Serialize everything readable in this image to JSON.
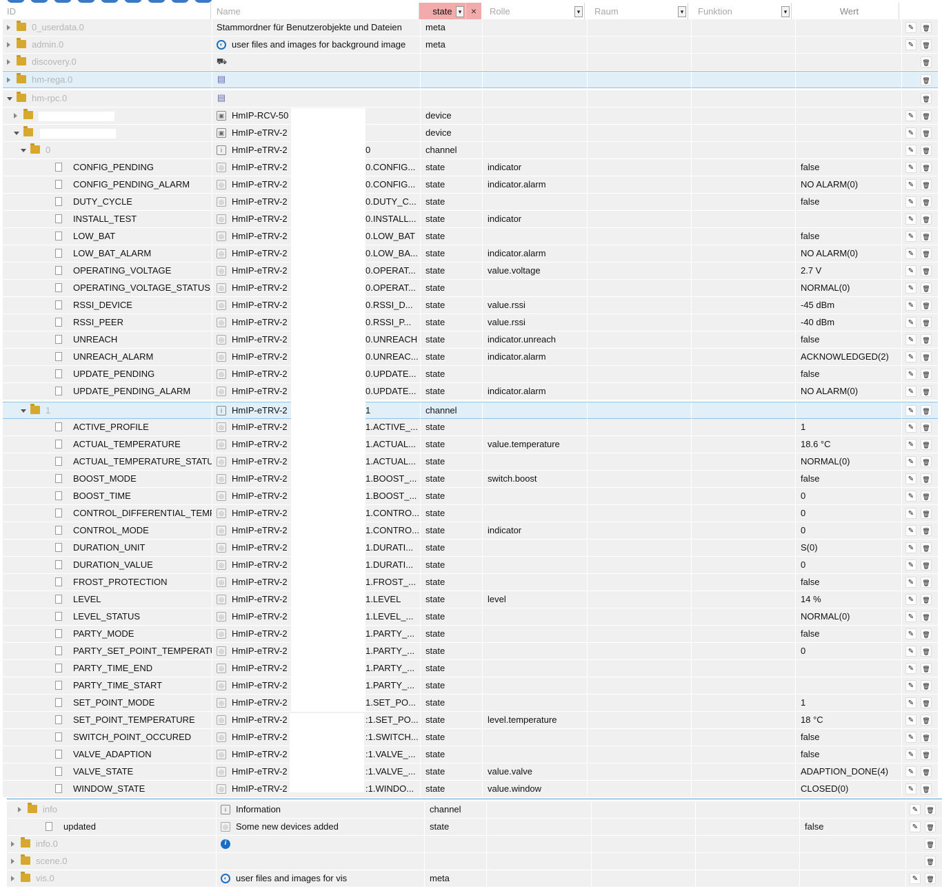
{
  "header": {
    "id_label": "ID",
    "name_label": "Name",
    "type_filter": "state",
    "role_label": "Rolle",
    "room_label": "Raum",
    "function_label": "Funktion",
    "value_label": "Wert",
    "clear_symbol": "×",
    "dropdown_symbol": "▾"
  },
  "rows": [
    {
      "id": "0_userdata.0",
      "name": "Stammordner für Benutzerobjekte und Dateien",
      "type": "meta",
      "role": "",
      "value": "",
      "level": 0,
      "kind": "folder",
      "toggle": "c",
      "icon": "",
      "dim": true,
      "edit": true
    },
    {
      "id": "admin.0",
      "name": "user files and images for background image",
      "type": "meta",
      "role": "",
      "value": "",
      "level": 0,
      "kind": "folder",
      "toggle": "c",
      "icon": "meta",
      "dim": true,
      "edit": true
    },
    {
      "id": "discovery.0",
      "name": "",
      "type": "",
      "role": "",
      "value": "",
      "level": 0,
      "kind": "folder",
      "toggle": "c",
      "icon": "bin",
      "dim": true,
      "edit": false
    },
    {
      "id": "hm-rega.0",
      "name": "",
      "type": "",
      "role": "",
      "value": "",
      "level": 0,
      "kind": "folder",
      "toggle": "c",
      "icon": "doc",
      "dim": true,
      "edit": false,
      "sel": true
    },
    {
      "id": "hm-rpc.0",
      "name": "",
      "type": "",
      "role": "",
      "value": "",
      "level": 0,
      "kind": "folder",
      "toggle": "o",
      "icon": "doc",
      "dim": true,
      "edit": false
    },
    {
      "id": "",
      "name": "HmIP-RCV-50",
      "type": "device",
      "role": "",
      "value": "",
      "level": 1,
      "kind": "folder",
      "toggle": "c",
      "icon": "dev",
      "dim": true,
      "edit": true
    },
    {
      "id": "",
      "name": "HmIP-eTRV-2",
      "type": "device",
      "role": "",
      "value": "",
      "level": 1,
      "kind": "folder",
      "toggle": "o",
      "icon": "dev",
      "dim": true,
      "edit": true
    },
    {
      "id": "0",
      "name": "HmIP-eTRV-2",
      "tail": "0",
      "type": "channel",
      "role": "",
      "value": "",
      "level": 2,
      "kind": "folder",
      "toggle": "o",
      "icon": "ch",
      "dim": true,
      "edit": true
    },
    {
      "id": "CONFIG_PENDING",
      "name": "HmIP-eTRV-2",
      "tail": "0.CONFIG...",
      "type": "state",
      "role": "indicator",
      "value": "false",
      "level": 3,
      "kind": "file",
      "icon": "st",
      "edit": true
    },
    {
      "id": "CONFIG_PENDING_ALARM",
      "name": "HmIP-eTRV-2",
      "tail": "0.CONFIG...",
      "type": "state",
      "role": "indicator.alarm",
      "value": "NO ALARM(0)",
      "level": 3,
      "kind": "file",
      "icon": "st",
      "edit": true
    },
    {
      "id": "DUTY_CYCLE",
      "name": "HmIP-eTRV-2",
      "tail": "0.DUTY_C...",
      "type": "state",
      "role": "",
      "value": "false",
      "level": 3,
      "kind": "file",
      "icon": "st",
      "edit": true
    },
    {
      "id": "INSTALL_TEST",
      "name": "HmIP-eTRV-2",
      "tail": "0.INSTALL...",
      "type": "state",
      "role": "indicator",
      "value": "",
      "level": 3,
      "kind": "file",
      "icon": "st",
      "edit": true
    },
    {
      "id": "LOW_BAT",
      "name": "HmIP-eTRV-2",
      "tail": "0.LOW_BAT",
      "type": "state",
      "role": "",
      "value": "false",
      "level": 3,
      "kind": "file",
      "icon": "st",
      "edit": true
    },
    {
      "id": "LOW_BAT_ALARM",
      "name": "HmIP-eTRV-2",
      "tail": "0.LOW_BA...",
      "type": "state",
      "role": "indicator.alarm",
      "value": "NO ALARM(0)",
      "level": 3,
      "kind": "file",
      "icon": "st",
      "edit": true
    },
    {
      "id": "OPERATING_VOLTAGE",
      "name": "HmIP-eTRV-2",
      "tail": "0.OPERAT...",
      "type": "state",
      "role": "value.voltage",
      "value": "2.7 V",
      "level": 3,
      "kind": "file",
      "icon": "st",
      "edit": true
    },
    {
      "id": "OPERATING_VOLTAGE_STATUS",
      "name": "HmIP-eTRV-2",
      "tail": "0.OPERAT...",
      "type": "state",
      "role": "",
      "value": "NORMAL(0)",
      "level": 3,
      "kind": "file",
      "icon": "st",
      "edit": true
    },
    {
      "id": "RSSI_DEVICE",
      "name": "HmIP-eTRV-2",
      "tail": "0.RSSI_D...",
      "type": "state",
      "role": "value.rssi",
      "value": "-45 dBm",
      "level": 3,
      "kind": "file",
      "icon": "st",
      "edit": true
    },
    {
      "id": "RSSI_PEER",
      "name": "HmIP-eTRV-2",
      "tail": "0.RSSI_P...",
      "type": "state",
      "role": "value.rssi",
      "value": "-40 dBm",
      "level": 3,
      "kind": "file",
      "icon": "st",
      "edit": true
    },
    {
      "id": "UNREACH",
      "name": "HmIP-eTRV-2",
      "tail": "0.UNREACH",
      "type": "state",
      "role": "indicator.unreach",
      "value": "false",
      "level": 3,
      "kind": "file",
      "icon": "st",
      "edit": true
    },
    {
      "id": "UNREACH_ALARM",
      "name": "HmIP-eTRV-2",
      "tail": "0.UNREAC...",
      "type": "state",
      "role": "indicator.alarm",
      "value": "ACKNOWLEDGED(2)",
      "level": 3,
      "kind": "file",
      "icon": "st",
      "edit": true
    },
    {
      "id": "UPDATE_PENDING",
      "name": "HmIP-eTRV-2",
      "tail": "0.UPDATE...",
      "type": "state",
      "role": "",
      "value": "false",
      "level": 3,
      "kind": "file",
      "icon": "st",
      "edit": true
    },
    {
      "id": "UPDATE_PENDING_ALARM",
      "name": "HmIP-eTRV-2",
      "tail": "0.UPDATE...",
      "type": "state",
      "role": "indicator.alarm",
      "value": "NO ALARM(0)",
      "level": 3,
      "kind": "file",
      "icon": "st",
      "edit": true
    },
    {
      "id": "1",
      "name": "HmIP-eTRV-2",
      "tail": "1",
      "type": "channel",
      "role": "",
      "value": "",
      "level": 2,
      "kind": "folder",
      "toggle": "o",
      "icon": "ch",
      "dim": true,
      "edit": true,
      "sel": true
    },
    {
      "id": "ACTIVE_PROFILE",
      "name": "HmIP-eTRV-2",
      "tail": "1.ACTIVE_...",
      "type": "state",
      "role": "",
      "value": "1",
      "level": 3,
      "kind": "file",
      "icon": "st",
      "edit": true
    },
    {
      "id": "ACTUAL_TEMPERATURE",
      "name": "HmIP-eTRV-2",
      "tail": "1.ACTUAL...",
      "type": "state",
      "role": "value.temperature",
      "value": "18.6 °C",
      "level": 3,
      "kind": "file",
      "icon": "st",
      "edit": true
    },
    {
      "id": "ACTUAL_TEMPERATURE_STATUS",
      "name": "HmIP-eTRV-2",
      "tail": "1.ACTUAL...",
      "type": "state",
      "role": "",
      "value": "NORMAL(0)",
      "level": 3,
      "kind": "file",
      "icon": "st",
      "edit": true
    },
    {
      "id": "BOOST_MODE",
      "name": "HmIP-eTRV-2",
      "tail": "1.BOOST_...",
      "type": "state",
      "role": "switch.boost",
      "value": "false",
      "level": 3,
      "kind": "file",
      "icon": "st",
      "edit": true
    },
    {
      "id": "BOOST_TIME",
      "name": "HmIP-eTRV-2",
      "tail": "1.BOOST_...",
      "type": "state",
      "role": "",
      "value": "0",
      "level": 3,
      "kind": "file",
      "icon": "st",
      "edit": true
    },
    {
      "id": "CONTROL_DIFFERENTIAL_TEMPERA",
      "name": "HmIP-eTRV-2",
      "tail": "1.CONTRO...",
      "type": "state",
      "role": "",
      "value": "0",
      "level": 3,
      "kind": "file",
      "icon": "st",
      "edit": true
    },
    {
      "id": "CONTROL_MODE",
      "name": "HmIP-eTRV-2",
      "tail": "1.CONTRO...",
      "type": "state",
      "role": "indicator",
      "value": "0",
      "level": 3,
      "kind": "file",
      "icon": "st",
      "edit": true
    },
    {
      "id": "DURATION_UNIT",
      "name": "HmIP-eTRV-2",
      "tail": "1.DURATI...",
      "type": "state",
      "role": "",
      "value": "S(0)",
      "level": 3,
      "kind": "file",
      "icon": "st",
      "edit": true
    },
    {
      "id": "DURATION_VALUE",
      "name": "HmIP-eTRV-2",
      "tail": "1.DURATI...",
      "type": "state",
      "role": "",
      "value": "0",
      "level": 3,
      "kind": "file",
      "icon": "st",
      "edit": true
    },
    {
      "id": "FROST_PROTECTION",
      "name": "HmIP-eTRV-2",
      "tail": "1.FROST_...",
      "type": "state",
      "role": "",
      "value": "false",
      "level": 3,
      "kind": "file",
      "icon": "st",
      "edit": true
    },
    {
      "id": "LEVEL",
      "name": "HmIP-eTRV-2",
      "tail": "1.LEVEL",
      "type": "state",
      "role": "level",
      "value": "14 %",
      "level": 3,
      "kind": "file",
      "icon": "st",
      "edit": true
    },
    {
      "id": "LEVEL_STATUS",
      "name": "HmIP-eTRV-2",
      "tail": "1.LEVEL_...",
      "type": "state",
      "role": "",
      "value": "NORMAL(0)",
      "level": 3,
      "kind": "file",
      "icon": "st",
      "edit": true
    },
    {
      "id": "PARTY_MODE",
      "name": "HmIP-eTRV-2",
      "tail": "1.PARTY_...",
      "type": "state",
      "role": "",
      "value": "false",
      "level": 3,
      "kind": "file",
      "icon": "st",
      "edit": true
    },
    {
      "id": "PARTY_SET_POINT_TEMPERATURE",
      "name": "HmIP-eTRV-2",
      "tail": "1.PARTY_...",
      "type": "state",
      "role": "",
      "value": "0",
      "level": 3,
      "kind": "file",
      "icon": "st",
      "edit": true
    },
    {
      "id": "PARTY_TIME_END",
      "name": "HmIP-eTRV-2",
      "tail": "1.PARTY_...",
      "type": "state",
      "role": "",
      "value": "",
      "level": 3,
      "kind": "file",
      "icon": "st",
      "edit": true
    },
    {
      "id": "PARTY_TIME_START",
      "name": "HmIP-eTRV-2",
      "tail": "1.PARTY_...",
      "type": "state",
      "role": "",
      "value": "",
      "level": 3,
      "kind": "file",
      "icon": "st",
      "edit": true
    },
    {
      "id": "SET_POINT_MODE",
      "name": "HmIP-eTRV-2",
      "tail": "1.SET_PO...",
      "type": "state",
      "role": "",
      "value": "1",
      "level": 3,
      "kind": "file",
      "icon": "st",
      "edit": true
    },
    {
      "id": "SET_POINT_TEMPERATURE",
      "name": "HmIP-eTRV-2",
      "tail": ":1.SET_PO...",
      "type": "state",
      "role": "level.temperature",
      "value": "18 °C",
      "level": 3,
      "kind": "file",
      "icon": "st",
      "edit": true
    },
    {
      "id": "SWITCH_POINT_OCCURED",
      "name": "HmIP-eTRV-2",
      "tail": ":1.SWITCH...",
      "type": "state",
      "role": "",
      "value": "false",
      "level": 3,
      "kind": "file",
      "icon": "st",
      "edit": true
    },
    {
      "id": "VALVE_ADAPTION",
      "name": "HmIP-eTRV-2",
      "tail": ":1.VALVE_...",
      "type": "state",
      "role": "",
      "value": "false",
      "level": 3,
      "kind": "file",
      "icon": "st",
      "edit": true
    },
    {
      "id": "VALVE_STATE",
      "name": "HmIP-eTRV-2",
      "tail": ":1.VALVE_...",
      "type": "state",
      "role": "value.valve",
      "value": "ADAPTION_DONE(4)",
      "level": 3,
      "kind": "file",
      "icon": "st",
      "edit": true
    },
    {
      "id": "WINDOW_STATE",
      "name": "HmIP-eTRV-2",
      "tail": ":1.WINDO...",
      "type": "state",
      "role": "value.window",
      "value": "CLOSED(0)",
      "level": 3,
      "kind": "file",
      "icon": "st",
      "edit": true
    },
    {
      "id": "info",
      "name": "Information",
      "type": "channel",
      "role": "",
      "value": "",
      "level": 1,
      "kind": "folder",
      "toggle": "c",
      "icon": "ch",
      "dim": true,
      "edit": true,
      "shift": true
    },
    {
      "id": "updated",
      "name": "Some new devices added",
      "type": "state",
      "role": "",
      "value": "false",
      "level": 1,
      "kind": "file",
      "icon": "st",
      "edit": true,
      "shift": true
    },
    {
      "id": "info.0",
      "name": "",
      "type": "",
      "role": "",
      "value": "",
      "level": 0,
      "kind": "folder",
      "toggle": "c",
      "icon": "info",
      "dim": true,
      "edit": false,
      "shift": true
    },
    {
      "id": "scene.0",
      "name": "",
      "type": "",
      "role": "",
      "value": "",
      "level": 0,
      "kind": "folder",
      "toggle": "c",
      "icon": "",
      "dim": true,
      "edit": false,
      "shift": true
    },
    {
      "id": "vis.0",
      "name": "user files and images for vis",
      "type": "meta",
      "role": "",
      "value": "",
      "level": 0,
      "kind": "folder",
      "toggle": "c",
      "icon": "meta",
      "dim": true,
      "edit": true,
      "shift": true
    }
  ],
  "icons": {
    "edit": "✎",
    "delete": "🗑",
    "channel": "i",
    "state": "◎",
    "info": "i",
    "meta": "◐",
    "bin": "⛟",
    "doc": "▤",
    "dev": "▣"
  }
}
